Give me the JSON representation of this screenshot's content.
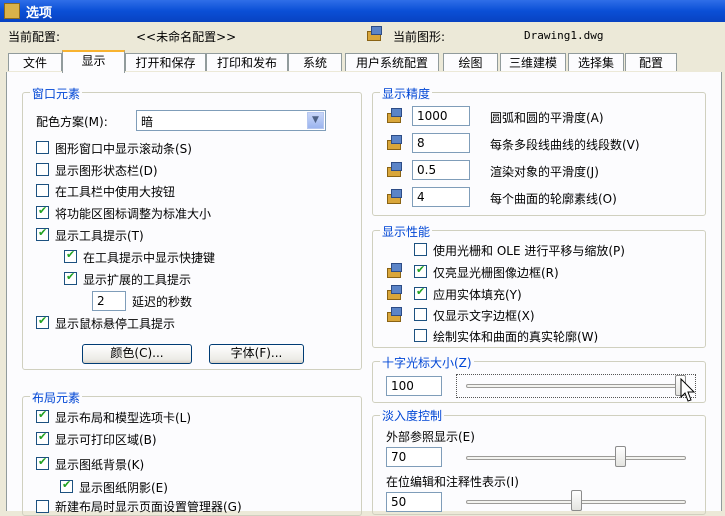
{
  "window": {
    "title": "选项"
  },
  "header": {
    "current_profile_label": "当前配置:",
    "current_profile_value": "<<未命名配置>>",
    "current_drawing_label": "当前图形:",
    "current_drawing_value": "Drawing1.dwg"
  },
  "tabs": [
    "文件",
    "显示",
    "打开和保存",
    "打印和发布",
    "系统",
    "用户系统配置",
    "绘图",
    "三维建模",
    "选择集",
    "配置"
  ],
  "active_tab": "显示",
  "window_elements": {
    "title": "窗口元素",
    "color_scheme_label": "配色方案(M):",
    "color_scheme_value": "暗",
    "checks": [
      {
        "label": "图形窗口中显示滚动条(S)",
        "checked": false
      },
      {
        "label": "显示图形状态栏(D)",
        "checked": false
      },
      {
        "label": "在工具栏中使用大按钮",
        "checked": false
      },
      {
        "label": "将功能区图标调整为标准大小",
        "checked": true
      },
      {
        "label": "显示工具提示(T)",
        "checked": true
      },
      {
        "label": "在工具提示中显示快捷键",
        "checked": true
      },
      {
        "label": "显示扩展的工具提示",
        "checked": true
      },
      {
        "label": "显示鼠标悬停工具提示",
        "checked": true
      }
    ],
    "delay_value": "2",
    "delay_label": "延迟的秒数",
    "colors_button": "颜色(C)...",
    "fonts_button": "字体(F)..."
  },
  "layout_elements": {
    "title": "布局元素",
    "checks": [
      {
        "label": "显示布局和模型选项卡(L)",
        "checked": true
      },
      {
        "label": "显示可打印区域(B)",
        "checked": true
      },
      {
        "label": "显示图纸背景(K)",
        "checked": true
      },
      {
        "label": "显示图纸阴影(E)",
        "checked": true
      },
      {
        "label": "新建布局时显示页面设置管理器(G)",
        "checked": false
      }
    ]
  },
  "display_resolution": {
    "title": "显示精度",
    "rows": [
      {
        "value": "1000",
        "label": "圆弧和圆的平滑度(A)"
      },
      {
        "value": "8",
        "label": "每条多段线曲线的线段数(V)"
      },
      {
        "value": "0.5",
        "label": "渲染对象的平滑度(J)"
      },
      {
        "value": "4",
        "label": "每个曲面的轮廓素线(O)"
      }
    ]
  },
  "display_performance": {
    "title": "显示性能",
    "checks": [
      {
        "label": "使用光栅和 OLE 进行平移与缩放(P)",
        "checked": false,
        "icon": false
      },
      {
        "label": "仅亮显光栅图像边框(R)",
        "checked": true,
        "icon": true
      },
      {
        "label": "应用实体填充(Y)",
        "checked": true,
        "icon": true
      },
      {
        "label": "仅显示文字边框(X)",
        "checked": false,
        "icon": true
      },
      {
        "label": "绘制实体和曲面的真实轮廓(W)",
        "checked": false,
        "icon": false
      }
    ]
  },
  "crosshair": {
    "title": "十字光标大小(Z)",
    "value": "100",
    "level": 1.0
  },
  "fade_control": {
    "title": "淡入度控制",
    "xref_label": "外部参照显示(E)",
    "xref_value": "70",
    "xref_level": 0.7,
    "inplace_label": "在位编辑和注释性表示(I)",
    "inplace_value": "50",
    "inplace_level": 0.5
  },
  "colors": {
    "group_title": "#0046d5",
    "title_bar": "#0a4fd6",
    "check": "#21a121",
    "tab_highlight": "#f8b330"
  }
}
